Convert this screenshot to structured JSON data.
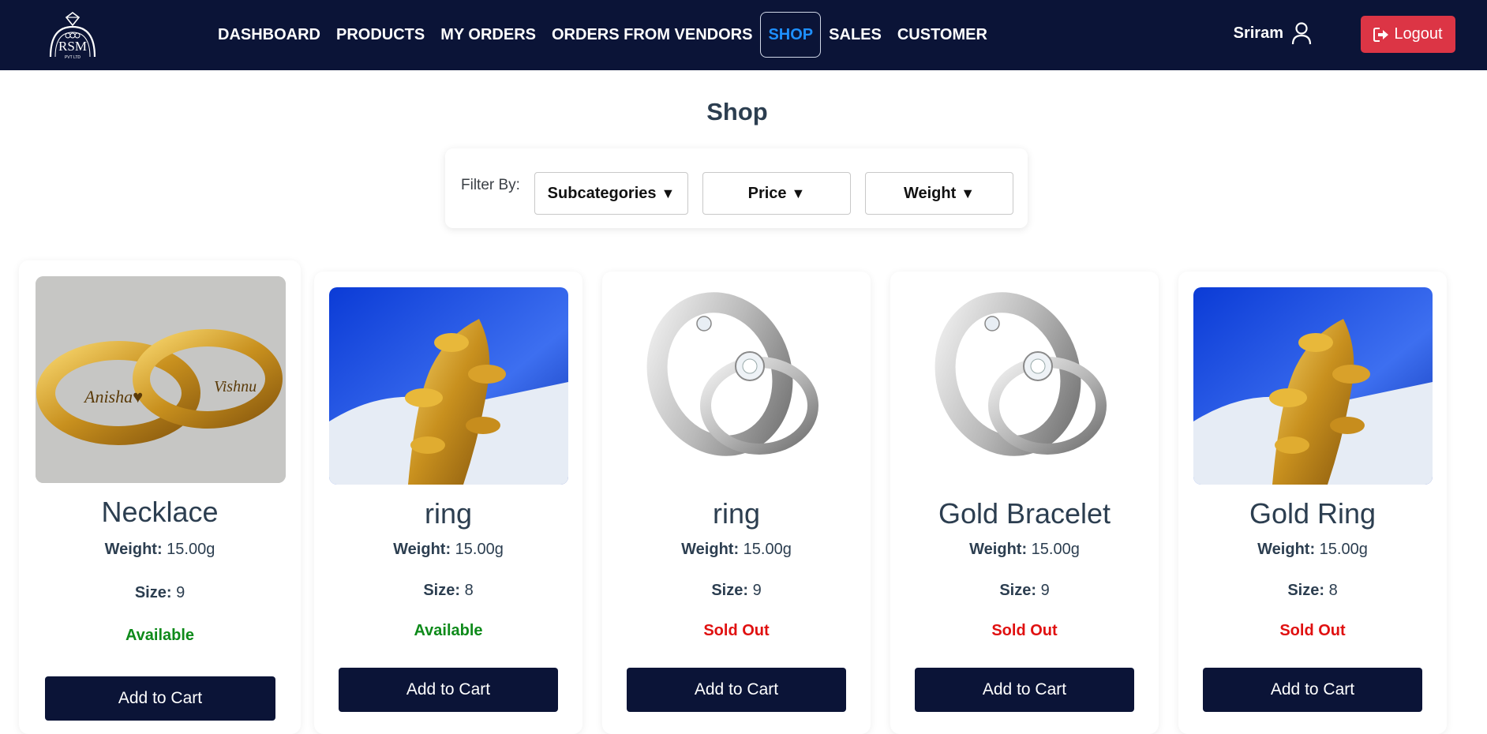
{
  "nav": {
    "brand_logo": "RSM PVT LTD",
    "links": [
      {
        "label": "DASHBOARD"
      },
      {
        "label": "PRODUCTS"
      },
      {
        "label": "MY ORDERS"
      },
      {
        "label": "ORDERS FROM VENDORS"
      },
      {
        "label": "SHOP",
        "active": true
      },
      {
        "label": "SALES"
      },
      {
        "label": "CUSTOMER"
      }
    ],
    "user_name": "Sriram",
    "user_icon": "user-icon",
    "logout_label": "Logout",
    "logout_icon": "sign-out-icon"
  },
  "page": {
    "title": "Shop"
  },
  "filter": {
    "label": "Filter By:",
    "subcategories_label": "Subcategories",
    "price_label": "Price",
    "weight_label": "Weight",
    "caret": "▼"
  },
  "products": [
    {
      "name": "Necklace",
      "weight_label": "Weight:",
      "weight": "15.00g",
      "size_label": "Size:",
      "size": "9",
      "status": "Available",
      "cart_label": "Add to Cart",
      "image": "engraved-gold-couple-rings"
    },
    {
      "name": "ring",
      "weight_label": "Weight:",
      "weight": "15.00g",
      "size_label": "Size:",
      "size": "8",
      "status": "Available",
      "cart_label": "Add to Cart",
      "image": "gold-leaf-ring"
    },
    {
      "name": "ring",
      "weight_label": "Weight:",
      "weight": "15.00g",
      "size_label": "Size:",
      "size": "9",
      "status": "Sold Out",
      "cart_label": "Add to Cart",
      "image": "silver-couple-rings"
    },
    {
      "name": "Gold Bracelet",
      "weight_label": "Weight:",
      "weight": "15.00g",
      "size_label": "Size:",
      "size": "9",
      "status": "Sold Out",
      "cart_label": "Add to Cart",
      "image": "silver-couple-rings"
    },
    {
      "name": "Gold Ring",
      "weight_label": "Weight:",
      "weight": "15.00g",
      "size_label": "Size:",
      "size": "8",
      "status": "Sold Out",
      "cart_label": "Add to Cart",
      "image": "gold-leaf-ring"
    }
  ],
  "colors": {
    "navbar": "#0b1437",
    "active_link": "#1e90ff",
    "logout": "#dc3545",
    "available": "#0e8a1a",
    "sold_out": "#e01010"
  }
}
